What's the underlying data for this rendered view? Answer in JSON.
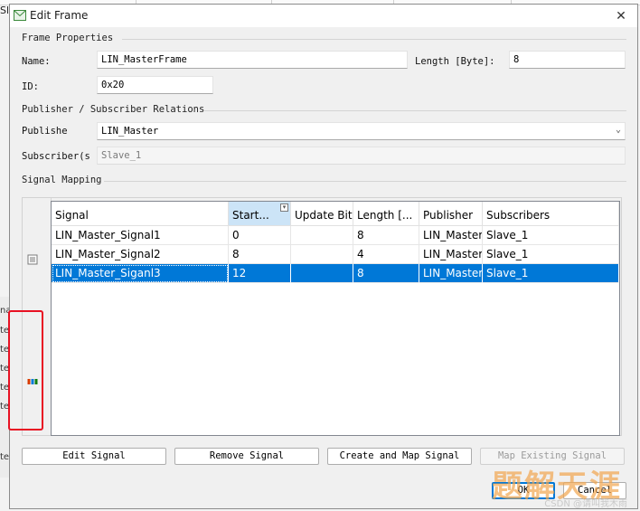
{
  "background": {
    "top_text": "Sl",
    "left_rows": [
      "na",
      "te",
      "te",
      "te",
      "te",
      "te",
      "te"
    ]
  },
  "dialog": {
    "title": "Edit Frame",
    "close_glyph": "✕"
  },
  "frame_properties": {
    "group_label": "Frame Properties",
    "name_label": "Name:",
    "name_value": "LIN_MasterFrame",
    "length_label": "Length [Byte]:",
    "length_value": "8",
    "id_label": "ID:",
    "id_value": "0x20"
  },
  "relations": {
    "group_label": "Publisher / Subscriber Relations",
    "publisher_label": "Publishe",
    "publisher_value": "LIN_Master",
    "subscriber_label": "Subscriber(s",
    "subscriber_value": "Slave_1"
  },
  "signal_mapping": {
    "group_label": "Signal Mapping",
    "columns": [
      "Signal",
      "Start...",
      "Update Bit",
      "Length [...",
      "Publisher",
      "Subscribers"
    ],
    "rows": [
      [
        "LIN_Master_Signal1",
        "0",
        "",
        "8",
        "LIN_Master",
        "Slave_1"
      ],
      [
        "LIN_Master_Signal2",
        "8",
        "",
        "4",
        "LIN_Master",
        "Slave_1"
      ],
      [
        "LIN_Master_Siganl3",
        "12",
        "",
        "8",
        "LIN_Master",
        "Slave_1"
      ]
    ],
    "selected_row": 2
  },
  "buttons": {
    "edit_signal": "Edit Signal",
    "remove_signal": "Remove Signal",
    "create_map": "Create and Map Signal",
    "map_existing": "Map Existing Signal",
    "ok": "OK",
    "cancel": "Cancel"
  },
  "watermark": {
    "text": "题解天涯",
    "caption": "CSDN @请叫我木雨"
  },
  "colors": {
    "selection": "#0078d7",
    "highlight_box": "#e81123",
    "sorted_header": "#cce4f7"
  }
}
